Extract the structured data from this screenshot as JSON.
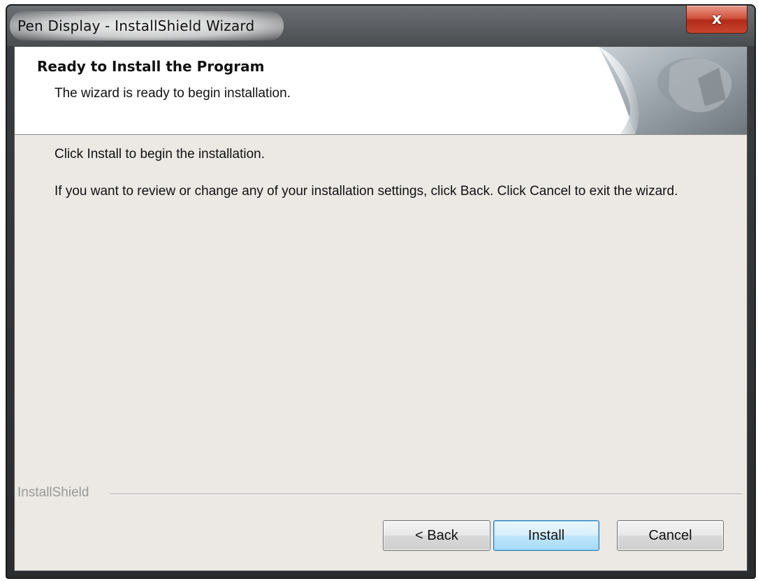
{
  "window": {
    "title": "Pen Display - InstallShield Wizard",
    "close_glyph": "x",
    "close_icon": "close-icon"
  },
  "header": {
    "title": "Ready to Install the Program",
    "subtitle": "The wizard is ready to begin installation.",
    "art_icon": "installshield-computer-art"
  },
  "body": {
    "line1": "Click Install to begin the installation.",
    "line2": "If you want to review or change any of your installation settings, click Back. Click Cancel to exit the wizard."
  },
  "footer": {
    "brand": "InstallShield"
  },
  "buttons": {
    "back": "< Back",
    "install": "Install",
    "cancel": "Cancel"
  },
  "colors": {
    "close_red": "#c8452f",
    "default_button_blue": "#3c7fb1",
    "client_background": "#ece9e5"
  }
}
